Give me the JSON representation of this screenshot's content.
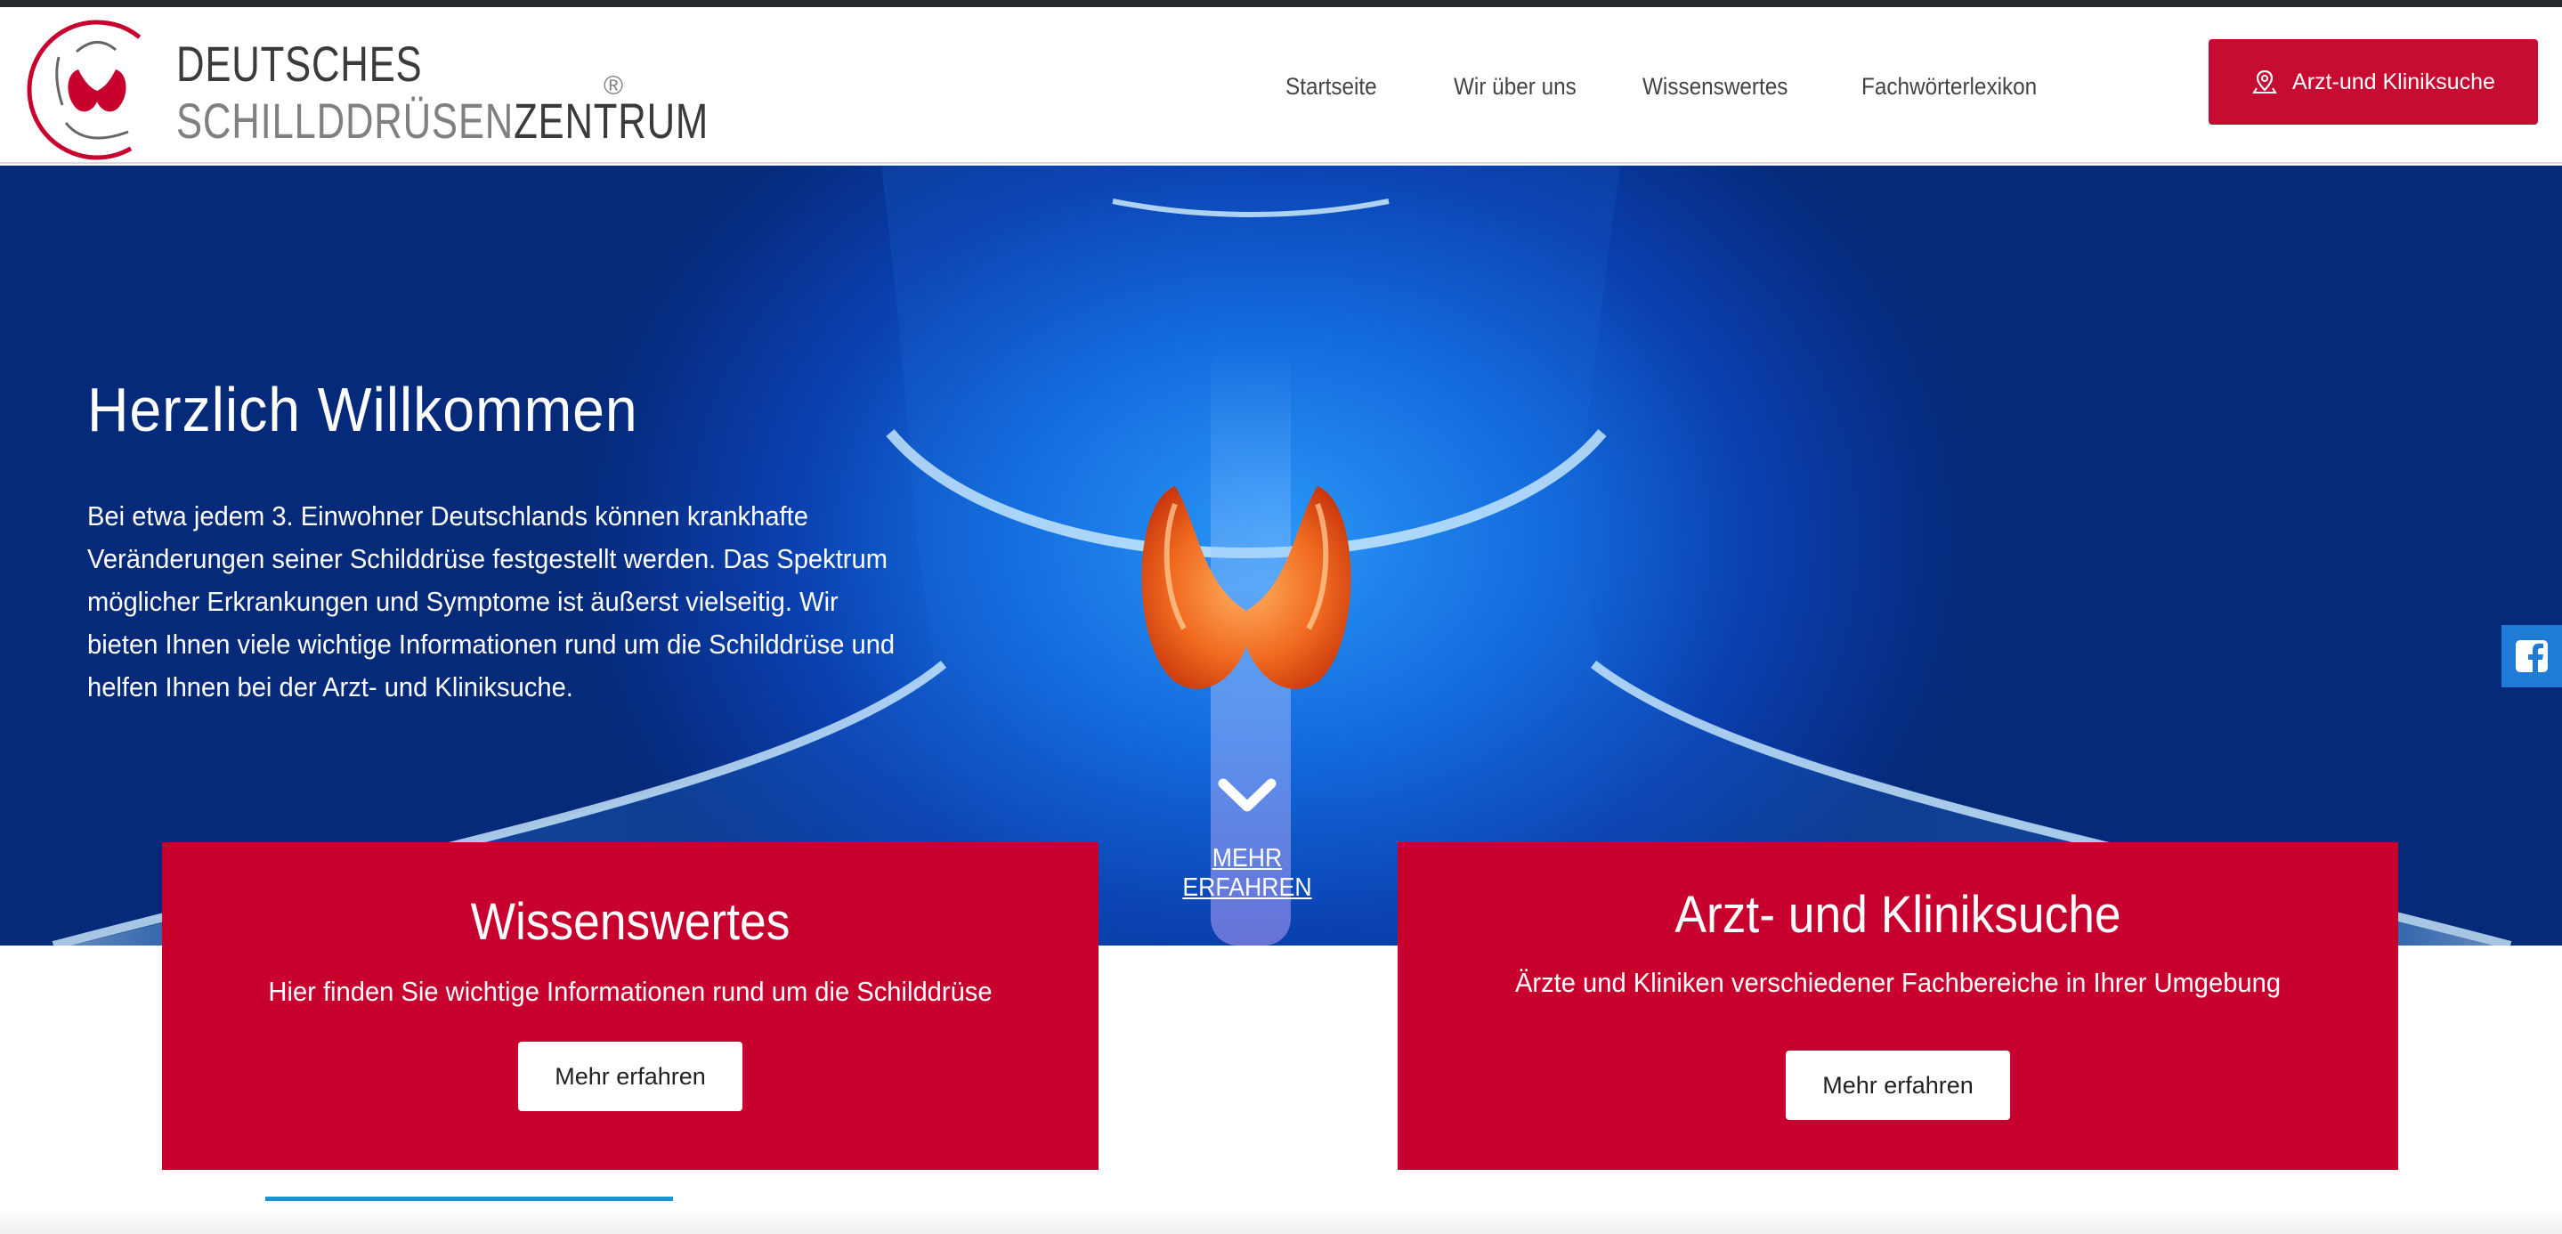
{
  "header": {
    "logo": {
      "line1": "DEUTSCHES",
      "line2_light": "SCHILLDDRÜSEN",
      "line2_strong": "ZENTRUM",
      "registered": "®"
    },
    "nav": [
      {
        "label": "Startseite"
      },
      {
        "label": "Wir über uns"
      },
      {
        "label": "Wissenswertes"
      },
      {
        "label": "Fachwörterlexikon"
      }
    ],
    "cta": {
      "label": "Arzt-und Kliniksuche",
      "icon": "map-pin-icon"
    }
  },
  "hero": {
    "title": "Herzlich Willkommen",
    "text": "Bei etwa jedem 3. Einwohner Deutschlands können krankhafte Veränderungen seiner Schilddrüse festgestellt werden. Das Spektrum möglicher Erkrankungen und Symptome ist äußerst vielseitig. Wir bieten Ihnen viele wichtige Informationen rund um die Schilddrüse und helfen Ihnen bei der Arzt- und Kliniksuche.",
    "scroll_icon": "chevron-down-icon",
    "more_link": "MEHR ERFAHREN"
  },
  "cards": [
    {
      "title": "Wissenswertes",
      "subtitle": "Hier finden Sie wichtige Informationen rund um die Schilddrüse",
      "button": "Mehr erfahren"
    },
    {
      "title": "Arzt- und Kliniksuche",
      "subtitle": "Ärzte und Kliniken verschiedener Fachbereiche in Ihrer Umgebung",
      "button": "Mehr erfahren"
    }
  ],
  "social": {
    "icon": "facebook-icon"
  },
  "colors": {
    "brand_red": "#c8002d",
    "hero_blue": "#146fe0",
    "facebook_blue": "#1f7bd6",
    "accent_line": "#1b93d4"
  }
}
